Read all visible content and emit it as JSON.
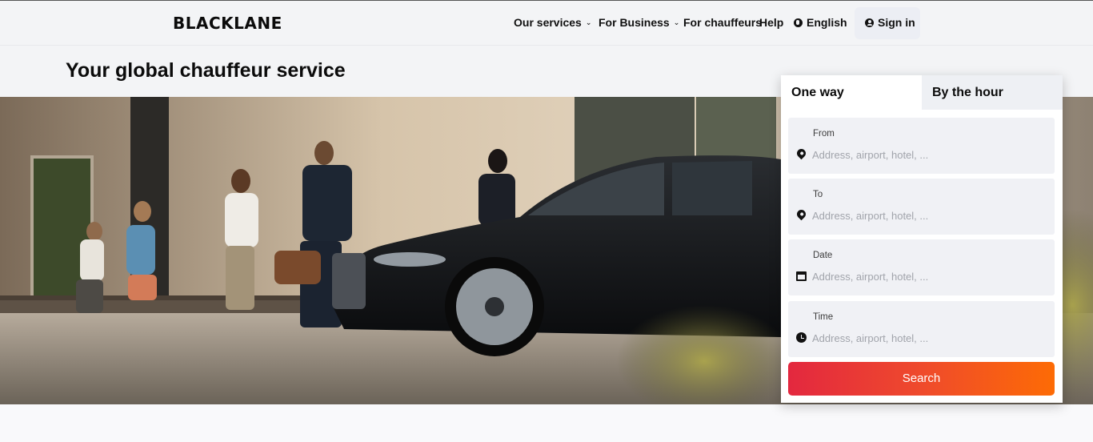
{
  "header": {
    "logo": "BLACKLANE",
    "nav": {
      "our_services": "Our services",
      "for_business": "For Business",
      "for_chauffeurs": "For chauffeurs",
      "help": "Help",
      "language": "English",
      "sign_in": "Sign in"
    },
    "icons": {
      "chevron": "chevron-down-icon",
      "language": "globe-icon",
      "account": "user-icon"
    }
  },
  "hero": {
    "title": "Your global chauffeur service",
    "image_alt": "hero-photo"
  },
  "booking": {
    "tabs": {
      "one_way": "One way",
      "by_the_hour": "By the hour"
    },
    "active_tab": "One way",
    "fields": {
      "from": {
        "label": "From",
        "placeholder": "Address, airport, hotel, ..."
      },
      "to": {
        "label": "To",
        "placeholder": "Address, airport, hotel, ..."
      },
      "date": {
        "label": "Date",
        "placeholder": "Address, airport, hotel, ..."
      },
      "time": {
        "label": "Time",
        "placeholder": "Address, airport, hotel, ..."
      }
    },
    "search_label": "Search",
    "colors": {
      "button_start": "#e3283f",
      "button_end": "#fd6b05"
    }
  }
}
